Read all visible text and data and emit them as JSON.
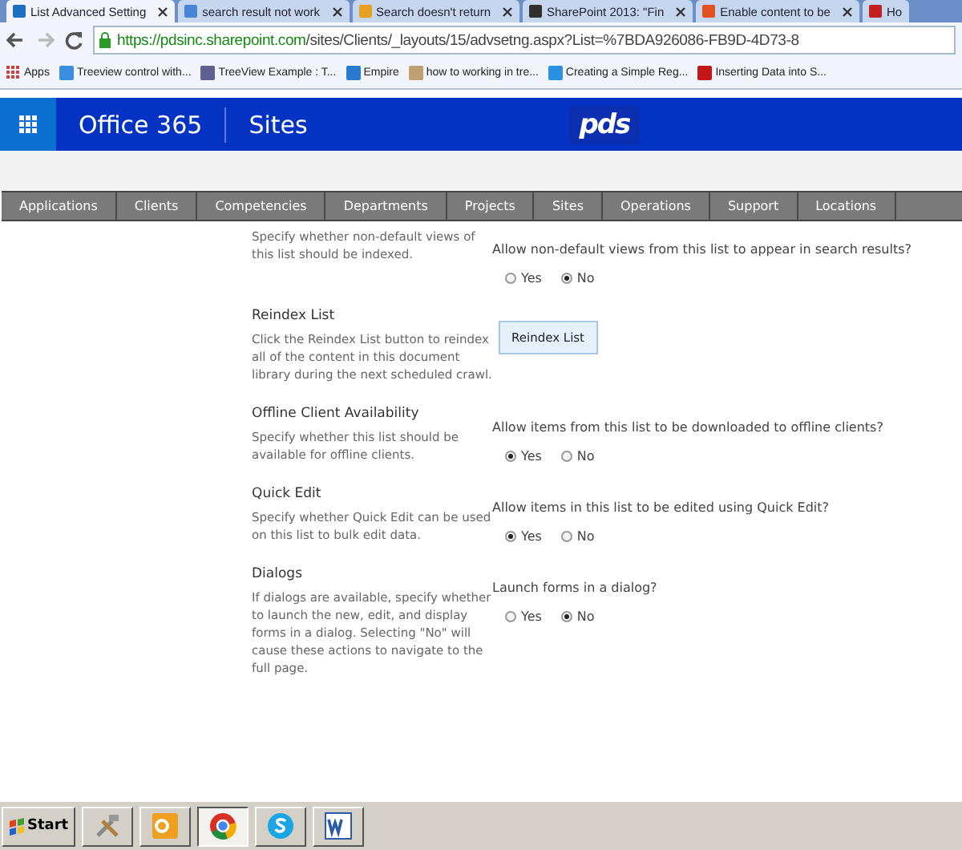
{
  "browser": {
    "tabs": [
      {
        "title": "List Advanced Setting",
        "selected": true,
        "color": "#1e6fc0"
      },
      {
        "title": "search result not work",
        "selected": false,
        "color": "#4a84d8"
      },
      {
        "title": "Search doesn't return",
        "selected": false,
        "color": "#e8a020"
      },
      {
        "title": "SharePoint 2013: \"Fin",
        "selected": false,
        "color": "#303030"
      },
      {
        "title": "Enable content to be",
        "selected": false,
        "color": "#e05020"
      },
      {
        "title": "Ho",
        "selected": false,
        "color": "#c02020"
      }
    ],
    "url": {
      "host": "https://pdsinc.sharepoint.com",
      "path": "/sites/Clients/_layouts/15/advsetng.aspx?List=%7BDA926086-FB9D-4D73-8"
    },
    "bookmarks": [
      {
        "label": "Apps",
        "color": "#d04040"
      },
      {
        "label": "Treeview control with...",
        "color": "#3a8ee0"
      },
      {
        "label": "TreeView Example : T...",
        "color": "#606090"
      },
      {
        "label": "Empire",
        "color": "#2a7ad0"
      },
      {
        "label": "how to working in tre...",
        "color": "#c0a070"
      },
      {
        "label": "Creating a Simple Reg...",
        "color": "#2a90e0"
      },
      {
        "label": "Inserting Data into S...",
        "color": "#c01818"
      }
    ]
  },
  "suite_bar": {
    "product": "Office 365",
    "section": "Sites",
    "logo": "pds"
  },
  "nav": [
    "Applications",
    "Clients",
    "Competencies",
    "Departments",
    "Projects",
    "Sites",
    "Operations",
    "Support",
    "Locations"
  ],
  "sections": [
    {
      "description": "Specify whether non-default views of this list should be indexed.",
      "kind": "radio",
      "question": "Allow non-default views from this list to appear in search results?",
      "options": [
        {
          "label": "Yes",
          "selected": false
        },
        {
          "label": "No",
          "selected": true
        }
      ]
    },
    {
      "title": "Reindex List",
      "description": "Click the Reindex List button to reindex all of the content in this document library during the next scheduled crawl.",
      "kind": "button",
      "button": "Reindex List"
    },
    {
      "title": "Offline Client Availability",
      "description": "Specify whether this list should be available for offline clients.",
      "kind": "radio",
      "question": "Allow items from this list to be downloaded to offline clients?",
      "options": [
        {
          "label": "Yes",
          "selected": true
        },
        {
          "label": "No",
          "selected": false
        }
      ]
    },
    {
      "title": "Quick Edit",
      "description": "Specify whether Quick Edit can be used on this list to bulk edit data.",
      "kind": "radio",
      "question": "Allow items in this list to be edited using Quick Edit?",
      "options": [
        {
          "label": "Yes",
          "selected": true
        },
        {
          "label": "No",
          "selected": false
        }
      ]
    },
    {
      "title": "Dialogs",
      "description": "If dialogs are available, specify whether to launch the new, edit, and display forms in a dialog. Selecting \"No\" will cause these actions to navigate to the full page.",
      "kind": "radio",
      "question": "Launch forms in a dialog?",
      "options": [
        {
          "label": "Yes",
          "selected": false
        },
        {
          "label": "No",
          "selected": true
        }
      ]
    }
  ],
  "taskbar": {
    "start": "Start",
    "apps": [
      {
        "kind": "tools",
        "selected": false
      },
      {
        "kind": "outlook",
        "selected": false
      },
      {
        "kind": "chrome",
        "selected": true
      },
      {
        "kind": "skype",
        "selected": false
      },
      {
        "kind": "word",
        "selected": false
      }
    ]
  }
}
